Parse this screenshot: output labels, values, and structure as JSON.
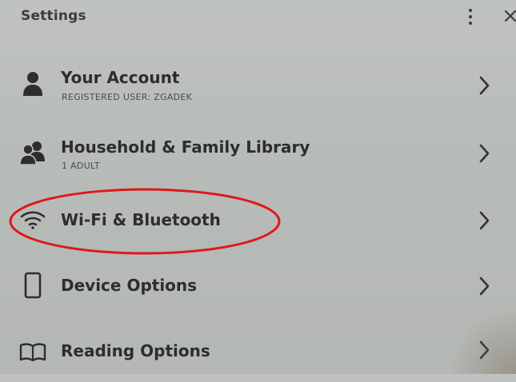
{
  "header": {
    "title": "Settings",
    "menu_icon": "kebab-menu-icon",
    "close_icon": "close-icon"
  },
  "items": [
    {
      "label": "Your Account",
      "sub": "REGISTERED USER: ZGADEK",
      "icon": "person-icon"
    },
    {
      "label": "Household & Family Library",
      "sub": "1 ADULT",
      "icon": "people-icon"
    },
    {
      "label": "Wi-Fi & Bluetooth",
      "sub": "",
      "icon": "wifi-icon",
      "highlighted": true
    },
    {
      "label": "Device Options",
      "sub": "",
      "icon": "device-icon"
    },
    {
      "label": "Reading Options",
      "sub": "",
      "icon": "book-icon"
    }
  ],
  "colors": {
    "background": "#bcbfbc",
    "text": "#2d2d2d",
    "highlight_ellipse": "#e01818"
  }
}
